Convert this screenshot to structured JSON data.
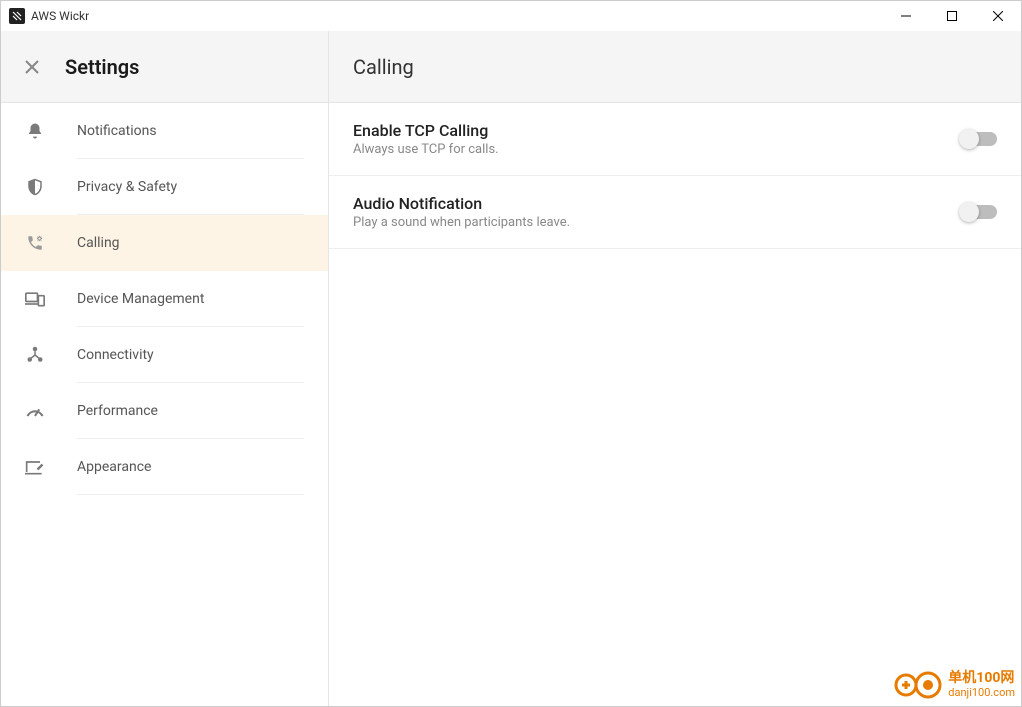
{
  "window": {
    "title": "AWS Wickr"
  },
  "sidebar": {
    "title": "Settings",
    "items": [
      {
        "label": "Notifications"
      },
      {
        "label": "Privacy & Safety"
      },
      {
        "label": "Calling"
      },
      {
        "label": "Device Management"
      },
      {
        "label": "Connectivity"
      },
      {
        "label": "Performance"
      },
      {
        "label": "Appearance"
      }
    ]
  },
  "main": {
    "title": "Calling",
    "settings": [
      {
        "title": "Enable TCP Calling",
        "desc": "Always use TCP for calls.",
        "enabled": false
      },
      {
        "title": "Audio Notification",
        "desc": "Play a sound when participants leave.",
        "enabled": false
      }
    ]
  },
  "watermark": {
    "cn": "单机100网",
    "url": "danji100.com"
  }
}
